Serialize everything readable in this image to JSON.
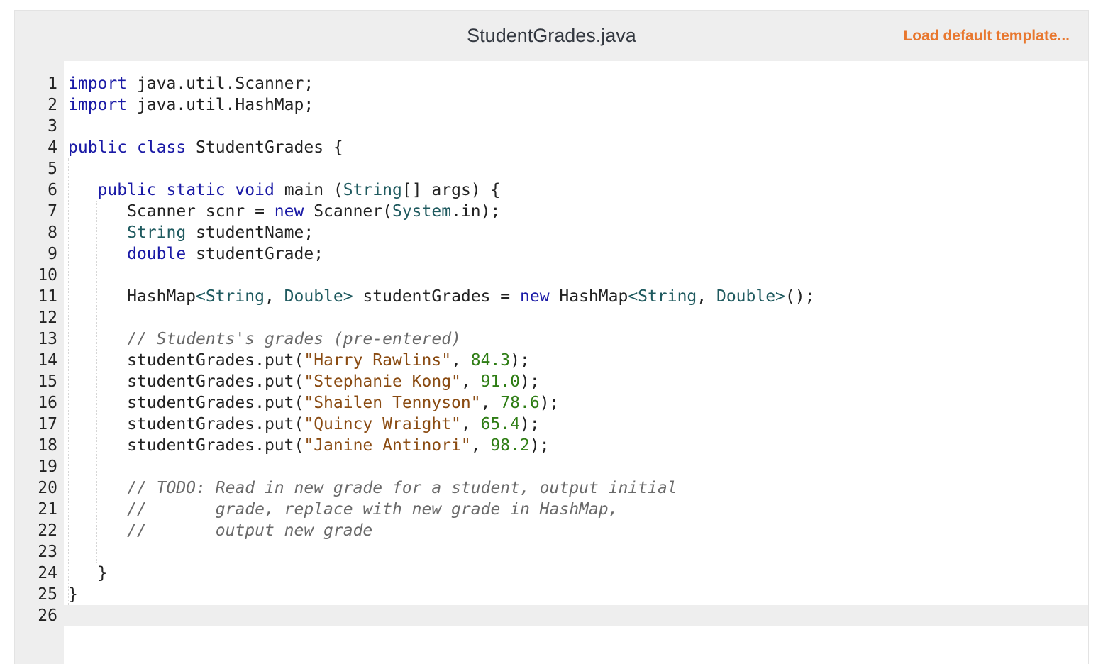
{
  "header": {
    "filename": "StudentGrades.java",
    "load_template_label": "Load default template..."
  },
  "editor": {
    "line_numbers": [
      "1",
      "2",
      "3",
      "4",
      "5",
      "6",
      "7",
      "8",
      "9",
      "10",
      "11",
      "12",
      "13",
      "14",
      "15",
      "16",
      "17",
      "18",
      "19",
      "20",
      "21",
      "22",
      "23",
      "24",
      "25",
      "26"
    ],
    "active_line": 26,
    "lines": [
      [
        {
          "t": "import",
          "c": "kw"
        },
        {
          "t": " java.util.Scanner;"
        }
      ],
      [
        {
          "t": "import",
          "c": "kw"
        },
        {
          "t": " java.util.HashMap;"
        }
      ],
      [],
      [
        {
          "t": "public",
          "c": "kw"
        },
        {
          "t": " "
        },
        {
          "t": "class",
          "c": "kw"
        },
        {
          "t": " StudentGrades {"
        }
      ],
      [],
      [
        {
          "t": "   "
        },
        {
          "t": "public",
          "c": "kw"
        },
        {
          "t": " "
        },
        {
          "t": "static",
          "c": "kw"
        },
        {
          "t": " "
        },
        {
          "t": "void",
          "c": "kw"
        },
        {
          "t": " main ("
        },
        {
          "t": "String",
          "c": "ty"
        },
        {
          "t": "[] args) {"
        }
      ],
      [
        {
          "t": "      Scanner scnr = "
        },
        {
          "t": "new",
          "c": "kw"
        },
        {
          "t": " Scanner("
        },
        {
          "t": "System",
          "c": "ty"
        },
        {
          "t": ".in);"
        }
      ],
      [
        {
          "t": "      "
        },
        {
          "t": "String",
          "c": "ty"
        },
        {
          "t": " studentName;"
        }
      ],
      [
        {
          "t": "      "
        },
        {
          "t": "double",
          "c": "kw"
        },
        {
          "t": " studentGrade;"
        }
      ],
      [],
      [
        {
          "t": "      HashMap"
        },
        {
          "t": "<String",
          "c": "ty"
        },
        {
          "t": ", "
        },
        {
          "t": "Double>",
          "c": "ty"
        },
        {
          "t": " studentGrades = "
        },
        {
          "t": "new",
          "c": "kw"
        },
        {
          "t": " HashMap"
        },
        {
          "t": "<String",
          "c": "ty"
        },
        {
          "t": ", "
        },
        {
          "t": "Double>",
          "c": "ty"
        },
        {
          "t": "();"
        }
      ],
      [],
      [
        {
          "t": "      "
        },
        {
          "t": "// Students's grades (pre-entered)",
          "c": "com"
        }
      ],
      [
        {
          "t": "      studentGrades.put("
        },
        {
          "t": "\"Harry Rawlins\"",
          "c": "str"
        },
        {
          "t": ", "
        },
        {
          "t": "84.3",
          "c": "num"
        },
        {
          "t": ");"
        }
      ],
      [
        {
          "t": "      studentGrades.put("
        },
        {
          "t": "\"Stephanie Kong\"",
          "c": "str"
        },
        {
          "t": ", "
        },
        {
          "t": "91.0",
          "c": "num"
        },
        {
          "t": ");"
        }
      ],
      [
        {
          "t": "      studentGrades.put("
        },
        {
          "t": "\"Shailen Tennyson\"",
          "c": "str"
        },
        {
          "t": ", "
        },
        {
          "t": "78.6",
          "c": "num"
        },
        {
          "t": ");"
        }
      ],
      [
        {
          "t": "      studentGrades.put("
        },
        {
          "t": "\"Quincy Wraight\"",
          "c": "str"
        },
        {
          "t": ", "
        },
        {
          "t": "65.4",
          "c": "num"
        },
        {
          "t": ");"
        }
      ],
      [
        {
          "t": "      studentGrades.put("
        },
        {
          "t": "\"Janine Antinori\"",
          "c": "str"
        },
        {
          "t": ", "
        },
        {
          "t": "98.2",
          "c": "num"
        },
        {
          "t": ");"
        }
      ],
      [],
      [
        {
          "t": "      "
        },
        {
          "t": "// TODO: Read in new grade for a student, output initial",
          "c": "com"
        }
      ],
      [
        {
          "t": "      "
        },
        {
          "t": "//       grade, replace with new grade in HashMap,",
          "c": "com"
        }
      ],
      [
        {
          "t": "      "
        },
        {
          "t": "//       output new grade",
          "c": "com"
        }
      ],
      [],
      [
        {
          "t": "   }"
        }
      ],
      [
        {
          "t": "}"
        }
      ],
      []
    ]
  }
}
